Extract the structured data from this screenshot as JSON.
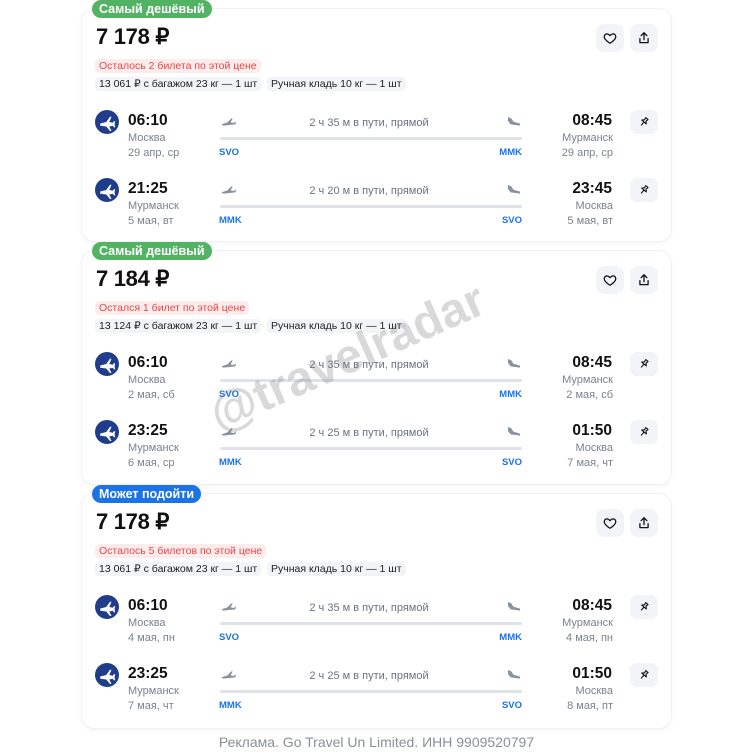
{
  "cards": [
    {
      "badge": "Самый дешёвый",
      "badge_color": "#53b365",
      "price": "7 178 ₽",
      "remaining": "Осталось 2 билета по этой цене",
      "baggage": "13 061 ₽ с багажом 23 кг — 1 шт",
      "carryon": "Ручная кладь 10 кг — 1 шт",
      "legs": [
        {
          "dep_time": "06:10",
          "dep_city": "Москва",
          "dep_date": "29 апр, ср",
          "duration": "2 ч 35 м в пути, прямой",
          "from_code": "SVO",
          "to_code": "MMK",
          "arr_time": "08:45",
          "arr_city": "Мурманск",
          "arr_date": "29 апр, ср"
        },
        {
          "dep_time": "21:25",
          "dep_city": "Мурманск",
          "dep_date": "5 мая, вт",
          "duration": "2 ч 20 м в пути, прямой",
          "from_code": "MMK",
          "to_code": "SVO",
          "arr_time": "23:45",
          "arr_city": "Москва",
          "arr_date": "5 мая, вт"
        }
      ]
    },
    {
      "badge": "Самый дешёвый",
      "badge_color": "#53b365",
      "price": "7 184 ₽",
      "remaining": "Остался 1 билет по этой цене",
      "baggage": "13 124 ₽ с багажом 23 кг — 1 шт",
      "carryon": "Ручная кладь 10 кг — 1 шт",
      "legs": [
        {
          "dep_time": "06:10",
          "dep_city": "Москва",
          "dep_date": "2 мая, сб",
          "duration": "2 ч 35 м в пути, прямой",
          "from_code": "SVO",
          "to_code": "MMK",
          "arr_time": "08:45",
          "arr_city": "Мурманск",
          "arr_date": "2 мая, сб"
        },
        {
          "dep_time": "23:25",
          "dep_city": "Мурманск",
          "dep_date": "6 мая, ср",
          "duration": "2 ч 25 м в пути, прямой",
          "from_code": "MMK",
          "to_code": "SVO",
          "arr_time": "01:50",
          "arr_city": "Москва",
          "arr_date": "7 мая, чт"
        }
      ]
    },
    {
      "badge": "Может подойти",
      "badge_color": "#1a73e8",
      "price": "7 178 ₽",
      "remaining": "Осталось 5 билетов по этой цене",
      "baggage": "13 061 ₽ с багажом 23 кг — 1 шт",
      "carryon": "Ручная кладь 10 кг — 1 шт",
      "legs": [
        {
          "dep_time": "06:10",
          "dep_city": "Москва",
          "dep_date": "4 мая, пн",
          "duration": "2 ч 35 м в пути, прямой",
          "from_code": "SVO",
          "to_code": "MMK",
          "arr_time": "08:45",
          "arr_city": "Мурманск",
          "arr_date": "4 мая, пн"
        },
        {
          "dep_time": "23:25",
          "dep_city": "Мурманск",
          "dep_date": "7 мая, чт",
          "duration": "2 ч 25 м в пути, прямой",
          "from_code": "MMK",
          "to_code": "SVO",
          "arr_time": "01:50",
          "arr_city": "Москва",
          "arr_date": "8 мая, пт"
        }
      ]
    }
  ],
  "watermark": "@travelradar",
  "footer_ad": "Реклама. Go Travel Un Limited. ИНН 9909520797",
  "icons": {
    "favorite": "heart-icon",
    "share": "share-icon",
    "pin": "pin-icon",
    "airline": "airline-logo-icon",
    "takeoff": "takeoff-icon",
    "landing": "landing-icon"
  }
}
